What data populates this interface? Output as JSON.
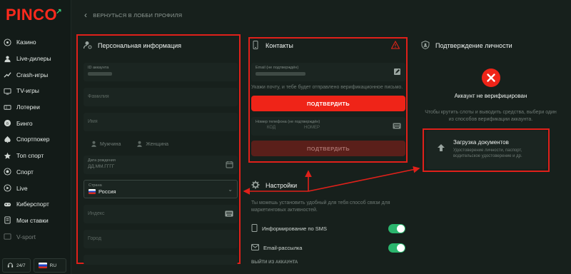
{
  "brand": {
    "logo_text": "PINCO",
    "logo_accent": "#ff2a1d"
  },
  "sidebar": {
    "items": [
      {
        "label": "Казино",
        "icon": "casino-icon"
      },
      {
        "label": "Live-дилеры",
        "icon": "live-dealer-icon"
      },
      {
        "label": "Crash-игры",
        "icon": "crash-icon"
      },
      {
        "label": "TV-игры",
        "icon": "tv-icon"
      },
      {
        "label": "Лотереи",
        "icon": "lottery-icon"
      },
      {
        "label": "Бинго",
        "icon": "bingo-icon"
      },
      {
        "label": "Спортпокер",
        "icon": "poker-icon"
      },
      {
        "label": "Топ спорт",
        "icon": "top-sport-icon"
      },
      {
        "label": "Спорт",
        "icon": "sport-icon"
      },
      {
        "label": "Live",
        "icon": "live-icon"
      },
      {
        "label": "Киберспорт",
        "icon": "esport-icon"
      },
      {
        "label": "Мои ставки",
        "icon": "bets-icon"
      },
      {
        "label": "V-sport",
        "icon": "vsport-icon"
      }
    ],
    "support_label": "24/7",
    "lang_label": "RU"
  },
  "back_link": "ВЕРНУТЬСЯ В ЛОББИ ПРОФИЛЯ",
  "personal": {
    "title": "Персональная информация",
    "account_id_label": "ID аккаунта",
    "surname_placeholder": "Фамилия",
    "name_placeholder": "Имя",
    "male_label": "Мужчина",
    "female_label": "Женщина",
    "birthdate_label": "Дата рождения",
    "birthdate_placeholder": "ДД.ММ.ГГГГ",
    "country_label": "Страна",
    "country_value": "Россия",
    "index_placeholder": "Индекс",
    "city_placeholder": "Город"
  },
  "contacts": {
    "title": "Контакты",
    "email_label": "Email (не подтверждён)",
    "email_hint": "Укажи почту, и тебе будет отправлено верификационное письмо.",
    "confirm_label": "ПОДТВЕРДИТЬ",
    "phone_label": "Номер телефона (не подтверждён)",
    "phone_code_placeholder": "КОД",
    "phone_number_placeholder": "НОМЕР",
    "confirm_phone_label": "ПОДТВЕРДИТЬ"
  },
  "settings": {
    "title": "Настройки",
    "description": "Ты можешь установить удобный для тебя способ связи для маркетинговых активностей.",
    "sms_label": "Информирование по SMS",
    "sms_enabled": true,
    "email_label": "Email-рассылка",
    "email_enabled": true,
    "logout_label": "ВЫЙТИ ИЗ АККАУНТА"
  },
  "verification": {
    "title": "Подтверждение личности",
    "status": "Аккаунт не верифицирован",
    "description": "Чтобы крутить слоты и выводить средства, выбери один из способов верификации аккаунта.",
    "upload_title": "Загрузка документов",
    "upload_desc": "Удостоверение личности, паспорт, водительское удостоверение и др."
  },
  "colors": {
    "accent_red": "#ef2418",
    "toggle_green": "#2bb56d",
    "annotation": "#e0201a"
  }
}
